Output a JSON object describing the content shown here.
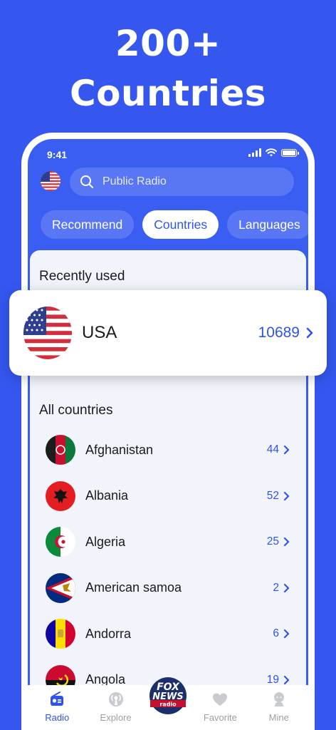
{
  "promo": {
    "line1": "200+",
    "line2": "Countries"
  },
  "status_bar": {
    "time": "9:41"
  },
  "header": {
    "search_placeholder": "Public Radio",
    "current_flag_icon": "usa-flag-icon"
  },
  "tabs": [
    {
      "label": "Recommend",
      "active": false
    },
    {
      "label": "Countries",
      "active": true
    },
    {
      "label": "Languages",
      "active": false
    }
  ],
  "recently_used": {
    "title": "Recently used",
    "item": {
      "name": "USA",
      "count": "10689"
    }
  },
  "all_countries": {
    "title": "All countries",
    "items": [
      {
        "name": "Afghanistan",
        "count": "44",
        "flag_icon": "afghanistan-flag-icon"
      },
      {
        "name": "Albania",
        "count": "52",
        "flag_icon": "albania-flag-icon"
      },
      {
        "name": "Algeria",
        "count": "25",
        "flag_icon": "algeria-flag-icon"
      },
      {
        "name": "American samoa",
        "count": "2",
        "flag_icon": "american-samoa-flag-icon"
      },
      {
        "name": "Andorra",
        "count": "6",
        "flag_icon": "andorra-flag-icon"
      },
      {
        "name": "Angola",
        "count": "19",
        "flag_icon": "angola-flag-icon"
      }
    ]
  },
  "bottom_nav": [
    {
      "label": "Radio",
      "icon": "radio-icon",
      "active": true
    },
    {
      "label": "Explore",
      "icon": "explore-icon",
      "active": false
    },
    {
      "label": "Favorite",
      "icon": "heart-icon",
      "active": false
    },
    {
      "label": "Mine",
      "icon": "user-icon",
      "active": false
    }
  ],
  "overlay_logo": {
    "text_top": "FOX",
    "text_bottom": "NEWS",
    "text_radio": "radio"
  },
  "colors": {
    "brand_blue": "#3557f0",
    "accent_blue": "#2f54ee",
    "sheet_bg": "#f1f4fa"
  }
}
